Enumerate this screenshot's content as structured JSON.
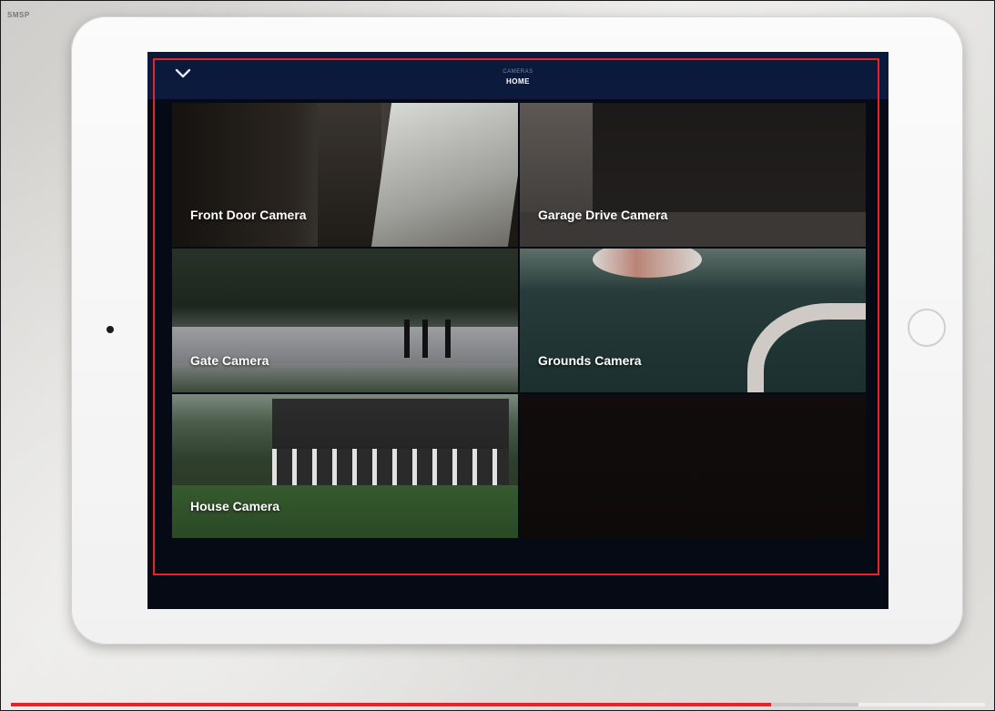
{
  "app": {
    "header": {
      "subtitle": "CAMERAS",
      "title": "HOME"
    },
    "cameras": [
      {
        "label": "Front Door Camera"
      },
      {
        "label": "Garage Drive Camera"
      },
      {
        "label": "Gate Camera"
      },
      {
        "label": "Grounds Camera"
      },
      {
        "label": "House Camera"
      }
    ]
  },
  "video": {
    "channel_logo": "SMSP",
    "progress_fraction": 0.78,
    "buffered_fraction": 0.87
  },
  "colors": {
    "accent_red": "#e8242a",
    "header_navy": "#0c1b3d"
  },
  "icons": {
    "collapse": "chevron-down-icon"
  }
}
